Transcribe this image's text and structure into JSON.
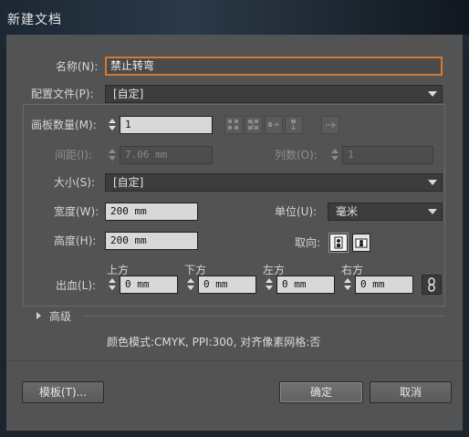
{
  "window": {
    "title": "新建文档"
  },
  "name_row": {
    "label": "名称(N):",
    "value": "禁止转弯"
  },
  "profile_row": {
    "label": "配置文件(P):",
    "value": "[自定]"
  },
  "artboards_row": {
    "label": "画板数量(M):",
    "value": "1"
  },
  "spacing_row": {
    "label": "间距(I):",
    "value": "7.06 mm"
  },
  "columns_row": {
    "label": "列数(O):",
    "value": "1"
  },
  "size_row": {
    "label": "大小(S):",
    "value": "[自定]"
  },
  "width_row": {
    "label": "宽度(W):",
    "value": "200 mm"
  },
  "units_row": {
    "label": "单位(U):",
    "value": "毫米"
  },
  "height_row": {
    "label": "高度(H):",
    "value": "200 mm"
  },
  "orientation_row": {
    "label": "取向:"
  },
  "bleed_row": {
    "label": "出血(L):",
    "top_label": "上方",
    "top_value": "0 mm",
    "bottom_label": "下方",
    "bottom_value": "0 mm",
    "left_label": "左方",
    "left_value": "0 mm",
    "right_label": "右方",
    "right_value": "0 mm"
  },
  "advanced": {
    "label": "高级"
  },
  "info_line": "颜色模式:CMYK, PPI:300, 对齐像素网格:否",
  "buttons": {
    "templates": "模板(T)...",
    "ok": "确定",
    "cancel": "取消"
  },
  "icons": {
    "grid_by_row": "grid-by-row-icon",
    "grid_by_column": "grid-by-column-icon",
    "arrange_by_row": "arrange-by-row-icon",
    "arrange_by_column": "arrange-by-column-icon",
    "right_to_left": "right-to-left-icon",
    "portrait": "portrait-icon",
    "landscape": "landscape-icon",
    "link": "link-chain-icon"
  },
  "colors": {
    "accent_focus": "#d27a33",
    "panel": "#535353",
    "titlebar": "#1d2a36"
  }
}
